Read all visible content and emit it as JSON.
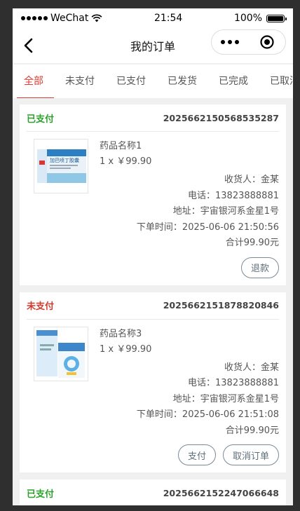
{
  "statusbar": {
    "carrier": "WeChat",
    "time": "21:54",
    "battery": "100%",
    "battery_level": 1.0
  },
  "navbar": {
    "title": "我的订单"
  },
  "tabs": [
    {
      "label": "全部",
      "active": true
    },
    {
      "label": "未支付"
    },
    {
      "label": "已支付"
    },
    {
      "label": "已发货"
    },
    {
      "label": "已完成"
    },
    {
      "label": "已取消"
    }
  ],
  "orders": [
    {
      "status": "已支付",
      "order_no": "2025662150568535287",
      "item_name": "药品名称1",
      "qty_price": "1 x ￥99.90",
      "receiver": "收货人：金某",
      "phone": "电话：13823888881",
      "address": "地址：宇宙银河系金星1号",
      "order_time": "下单时间：2025-06-06 21:50:56",
      "total": "合计99.90元",
      "buttons": [
        "退款"
      ],
      "product_text": "加巴喷丁胶囊"
    },
    {
      "status": "未支付",
      "order_no": "2025662151878820846",
      "item_name": "药品名称3",
      "qty_price": "1 x ￥99.90",
      "receiver": "收货人：金某",
      "phone": "电话：13823888881",
      "address": "地址：宇宙银河系金星1号",
      "order_time": "下单时间：2025-06-06 21:51:08",
      "total": "合计99.90元",
      "buttons": [
        "支付",
        "取消订单"
      ]
    },
    {
      "status": "已支付",
      "order_no": "2025662152247066648"
    }
  ],
  "colors": {
    "paid": "#2aa22a",
    "unpaid": "#d33a2c",
    "accent": "#e03b2f"
  }
}
